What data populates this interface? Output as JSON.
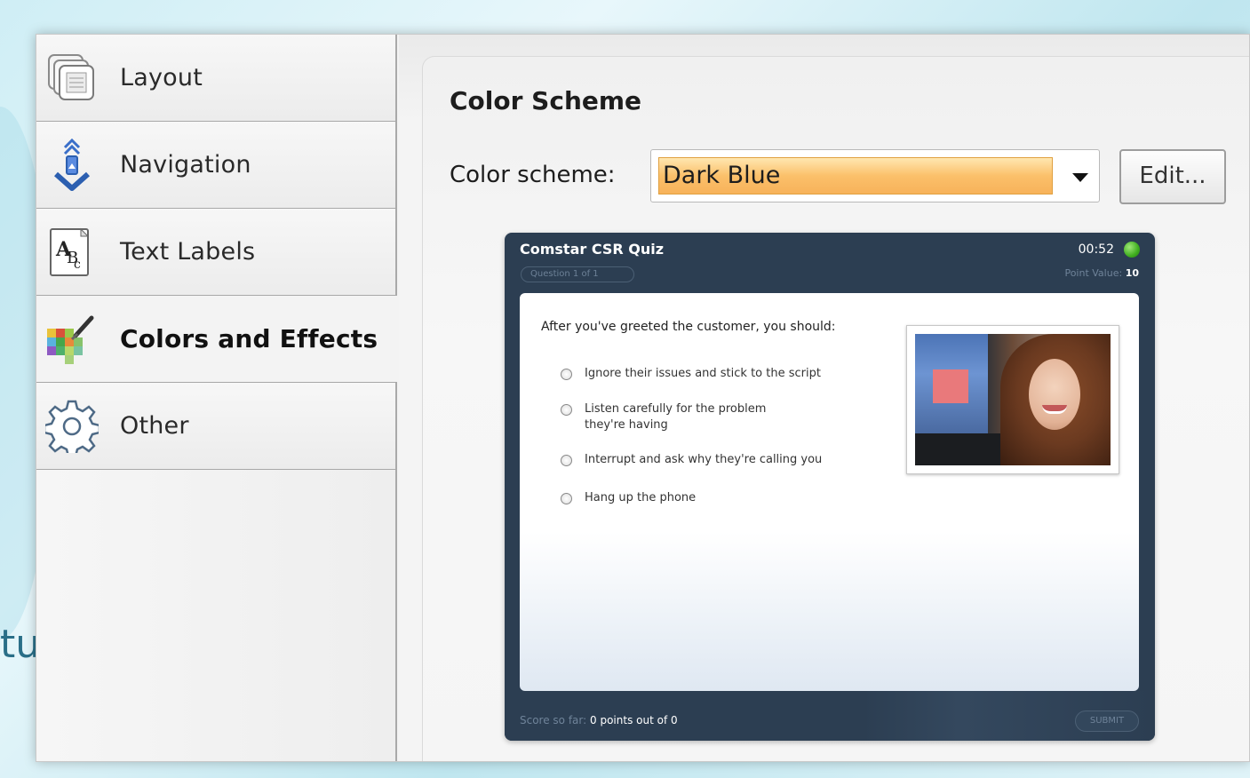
{
  "sidebar": {
    "items": [
      {
        "label": "Layout",
        "icon": "layout-icon",
        "active": false
      },
      {
        "label": "Navigation",
        "icon": "navigation-icon",
        "active": false
      },
      {
        "label": "Text Labels",
        "icon": "text-labels-icon",
        "active": false
      },
      {
        "label": "Colors and Effects",
        "icon": "colors-effects-icon",
        "active": true
      },
      {
        "label": "Other",
        "icon": "gear-icon",
        "active": false
      }
    ]
  },
  "background": {
    "fragment_text": "tu"
  },
  "main": {
    "section_title": "Color Scheme",
    "scheme_label": "Color scheme:",
    "scheme_value": "Dark Blue",
    "edit_label": "Edit..."
  },
  "preview": {
    "title": "Comstar CSR Quiz",
    "timer": "00:52",
    "question_number": "Question 1 of 1",
    "point_value_label": "Point Value:",
    "point_value": "10",
    "question": "After you've greeted the customer, you should:",
    "options": [
      "Ignore their issues and stick to the script",
      "Listen carefully for the problem they're having",
      "Interrupt and ask why they're calling you",
      "Hang up the phone"
    ],
    "score_label": "Score so far:",
    "score_value": "0 points out of 0",
    "submit_label": "SUBMIT"
  },
  "colors": {
    "accent_orange": "#f7b25a",
    "quiz_dark_blue": "#2c3e52",
    "status_green": "#3fae1f"
  }
}
